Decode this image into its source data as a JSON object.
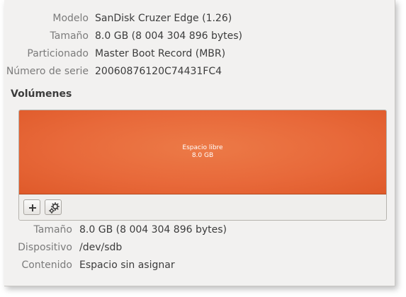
{
  "drive": {
    "model_label": "Modelo",
    "model_value": "SanDisk Cruzer Edge (1.26)",
    "size_label": "Tamaño",
    "size_value": "8.0 GB (8 004 304 896 bytes)",
    "partitioning_label": "Particionado",
    "partitioning_value": "Master Boot Record (MBR)",
    "serial_label": "Número de serie",
    "serial_value": "20060876120C74431FC4"
  },
  "volumes": {
    "title": "Volúmenes",
    "free_space": {
      "label": "Espacio libre",
      "size": "8.0 GB",
      "color": "#e8693a"
    },
    "toolbar": {
      "add_icon": "plus-icon",
      "settings_icon": "gears-icon"
    }
  },
  "selected": {
    "size_label": "Tamaño",
    "size_value": "8.0 GB (8 004 304 896 bytes)",
    "device_label": "Dispositivo",
    "device_value": "/dev/sdb",
    "contents_label": "Contenido",
    "contents_value": "Espacio sin asignar"
  }
}
